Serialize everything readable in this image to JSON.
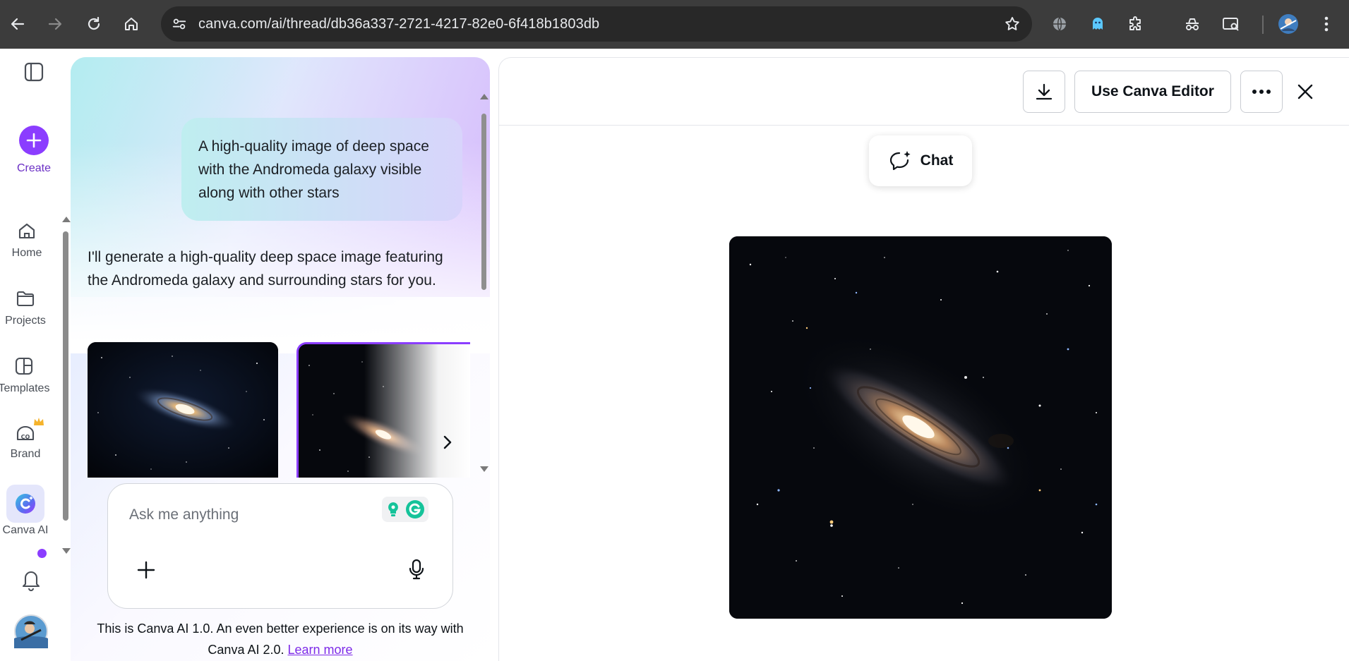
{
  "browser": {
    "url": "canva.com/ai/thread/db36a337-2721-4217-82e0-6f418b1803db"
  },
  "rail": {
    "create_label": "Create",
    "items": [
      {
        "label": "Home"
      },
      {
        "label": "Projects"
      },
      {
        "label": "Templates"
      },
      {
        "label": "Brand"
      },
      {
        "label": "Canva AI"
      }
    ]
  },
  "chat": {
    "user_message": "A high-quality image of deep space with the Andromeda galaxy visible along with other stars",
    "assistant_message": "I'll generate a high-quality deep space image featuring the Andromeda galaxy and surrounding stars for you.",
    "composer_placeholder": "Ask me anything",
    "footnote_text": "This is Canva AI 1.0. An even better experience is on its way with Canva AI 2.0.",
    "footnote_link": "Learn more"
  },
  "preview": {
    "editor_button": "Use Canva Editor",
    "chat_button": "Chat"
  },
  "colors": {
    "brand_purple": "#8b3dff",
    "link_purple": "#7d2ae8",
    "chrome_bg": "#3c3c3c"
  },
  "icons": [
    "back-arrow-icon",
    "forward-arrow-icon",
    "reload-icon",
    "home-icon",
    "site-settings-icon",
    "star-icon",
    "globe-icon",
    "ghost-icon",
    "puzzle-icon",
    "spy-icon",
    "search-tab-icon",
    "profile-avatar-icon",
    "kebab-icon",
    "sidebar-toggle-icon",
    "plus-icon",
    "folder-icon",
    "templates-icon",
    "brand-icon",
    "crown-icon",
    "canva-ai-icon",
    "bell-icon",
    "download-icon",
    "more-icon",
    "close-icon",
    "chat-sparkle-icon",
    "chevron-right-icon",
    "mic-icon",
    "grammarly-icon"
  ]
}
